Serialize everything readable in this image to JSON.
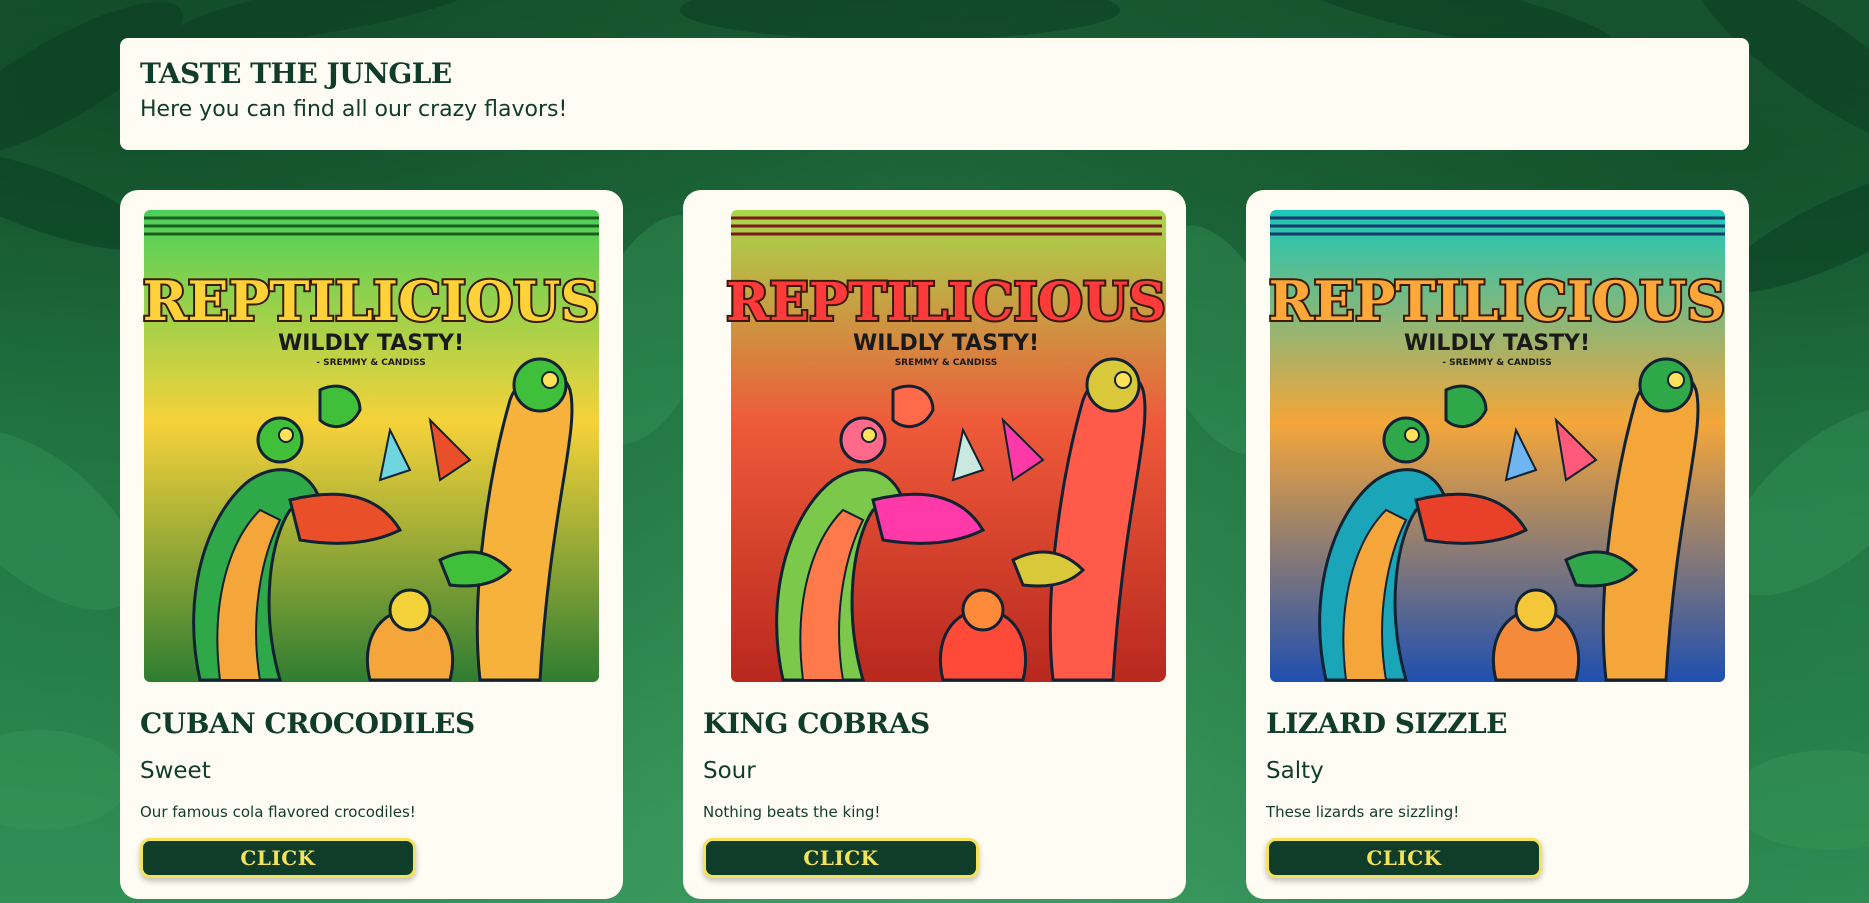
{
  "header": {
    "title": "TASTE THE JUNGLE",
    "subtitle": "Here you can find all our crazy flavors!"
  },
  "products": [
    {
      "name": "CUBAN CROCODILES",
      "flavor": "Sweet",
      "description": "Our famous cola flavored crocodiles!",
      "button_label": "CLICK",
      "packaging": {
        "brand": "REPTILICIOUS",
        "tagline": "WILDLY TASTY!",
        "small_print": "- SREMMY & CANDISS",
        "theme_colors": [
          "#f6d23a",
          "#3fbf3a",
          "#e9502a"
        ]
      }
    },
    {
      "name": "KING COBRAS",
      "flavor": "Sour",
      "description": "Nothing beats the king!",
      "button_label": "CLICK",
      "packaging": {
        "brand": "REPTILICIOUS",
        "tagline": "WILDLY TASTY!",
        "small_print": "SREMMY & CANDISS",
        "theme_colors": [
          "#ef3a3a",
          "#ff6a8a",
          "#a7d84a"
        ]
      }
    },
    {
      "name": "LIZARD SIZZLE",
      "flavor": "Salty",
      "description": "These lizards are sizzling!",
      "button_label": "CLICK",
      "packaging": {
        "brand": "REPTILICIOUS",
        "tagline": "WILDLY TASTY!",
        "small_print": "- SREMMY & CANDISS",
        "theme_colors": [
          "#1aa6b8",
          "#2a5fd8",
          "#f4a63a"
        ]
      }
    }
  ],
  "colors": {
    "card_background": "#fffcf4",
    "dark_green": "#0f3d2a",
    "button_accent": "#f4e25a"
  }
}
